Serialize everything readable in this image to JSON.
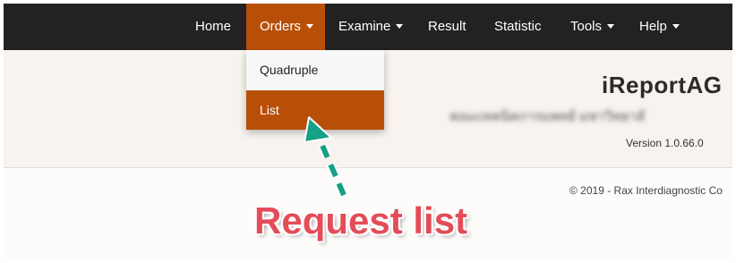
{
  "nav": {
    "items": [
      {
        "label": "Home",
        "dropdown": false,
        "active": false
      },
      {
        "label": "Orders",
        "dropdown": true,
        "active": true
      },
      {
        "label": "Examine",
        "dropdown": true,
        "active": false
      },
      {
        "label": "Result",
        "dropdown": false,
        "active": false
      },
      {
        "label": "Statistic",
        "dropdown": false,
        "active": false
      },
      {
        "label": "Tools",
        "dropdown": true,
        "active": false
      },
      {
        "label": "Help",
        "dropdown": true,
        "active": false
      }
    ]
  },
  "orders_menu": {
    "items": [
      {
        "label": "Quadruple",
        "active": false
      },
      {
        "label": "List",
        "active": true
      }
    ]
  },
  "header": {
    "brand": "iReportAG",
    "organization": "คณะเทคนิคการแพทย์ มหาวิทยาลั",
    "version": "Version 1.0.66.0"
  },
  "footer": {
    "copyright": "© 2019 - Rax Interdiagnostic Co"
  },
  "annotation": {
    "text": "Request list",
    "text_color": "#e34c58",
    "arrow_color": "#16a085",
    "arrow_icon": "dashed-arrow-up-left-icon"
  },
  "colors": {
    "navbar_bg": "#222222",
    "accent": "#b84f08",
    "header_bg": "#f8f3ee"
  }
}
